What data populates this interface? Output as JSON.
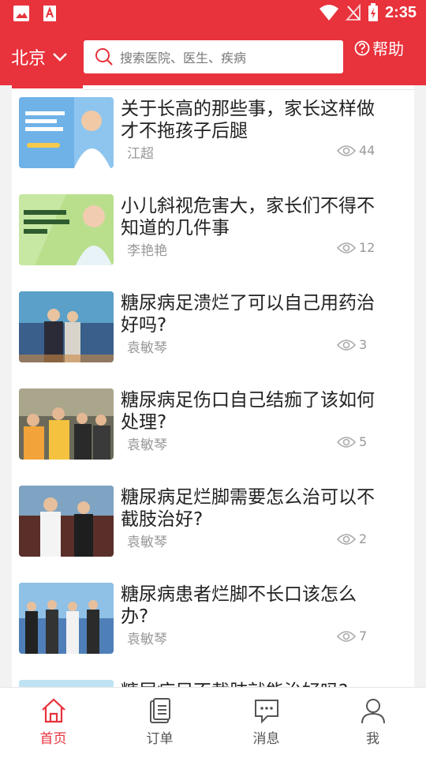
{
  "status_bar": {
    "time": "2:35"
  },
  "header": {
    "city": "北京",
    "search_placeholder": "搜索医院、医生、疾病",
    "help": "帮助"
  },
  "articles": [
    {
      "title": "关于长高的那些事，家长这样做才不拖孩子后腿",
      "author": "江超",
      "views": "44"
    },
    {
      "title": "小儿斜视危害大，家长们不得不知道的几件事",
      "author": "李艳艳",
      "views": "12"
    },
    {
      "title": "糖尿病足溃烂了可以自己用药治好吗?",
      "author": "袁敏琴",
      "views": "3"
    },
    {
      "title": "糖尿病足伤口自己结痂了该如何处理?",
      "author": "袁敏琴",
      "views": "5"
    },
    {
      "title": "糖尿病足烂脚需要怎么治可以不截肢治好?",
      "author": "袁敏琴",
      "views": "2"
    },
    {
      "title": "糖尿病患者烂脚不长口该怎么办?",
      "author": "袁敏琴",
      "views": "7"
    },
    {
      "title": "糖尿病足不截肢就能治好吗?",
      "author": "",
      "views": ""
    }
  ],
  "nav": {
    "home": "首页",
    "orders": "订单",
    "messages": "消息",
    "me": "我"
  },
  "colors": {
    "brand": "#e8323c"
  }
}
